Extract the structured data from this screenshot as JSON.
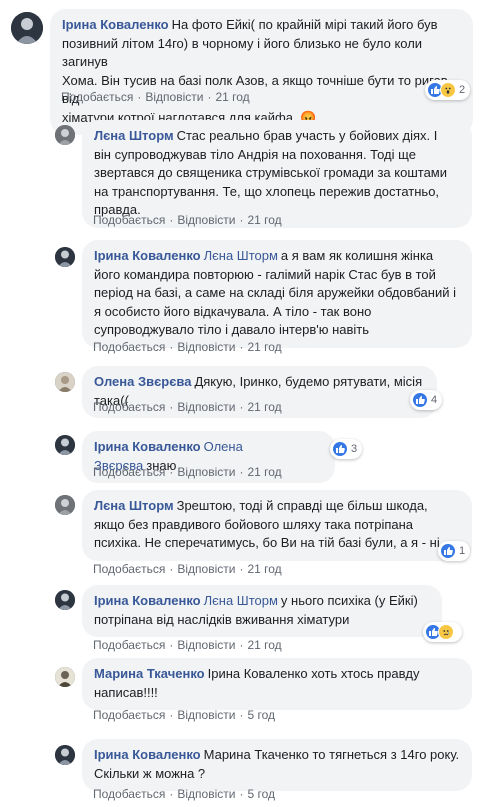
{
  "actions": {
    "like": "Подобається",
    "reply": "Відповісти",
    "dot": "·"
  },
  "comments": [
    {
      "author": "Ірина Коваленко",
      "text_lines": [
        "На фото Ейкі( по крайній мірі такий його був",
        "позивний літом 14го) в чорному і його близько не було коли загинув",
        "Хома. Він тусив на базі полк Азов, а якщо точніше бути то ригав від",
        "хіматури котрої наглотався для кайфа. 😡"
      ],
      "time": "21 год",
      "reactions": {
        "icons": [
          "like-icon",
          "wow-icon"
        ],
        "count": "2"
      }
    },
    {
      "author": "Лєна Шторм",
      "text_lines": [
        "Стас реально брав участь у бойових діях. І",
        "він супроводжував тіло Андрія на поховання. Тоді ще",
        "звертався до священика струмівської громади за коштами",
        "на транспортування. Те, що хлопець пережив достатньо,",
        "правда."
      ],
      "time": "21 год"
    },
    {
      "author": "Ірина Коваленко",
      "mention": "Лєна Шторм",
      "text_lines": [
        "а я вам як колишня жінка",
        "його командира повторюю - галімий нарік Стас був в той",
        "період на базі, а саме на складі біля аружейки обдовбаний і",
        "я особисто його відкачувала. А тіло - так воно",
        "супроводжувало тіло і давало інтерв'ю навіть"
      ],
      "time": "21 год"
    },
    {
      "author": "Олена Звєрєва",
      "text_lines": [
        "Дякую, Іринко, будемо рятувати, місія така(("
      ],
      "time": "21 год",
      "reactions": {
        "icons": [
          "like-icon"
        ],
        "count": "4"
      }
    },
    {
      "author": "Ірина Коваленко",
      "mention": "Олена Звєрєва",
      "text_lines": [
        "знаю"
      ],
      "time": "21 год",
      "reactions": {
        "icons": [
          "like-icon"
        ],
        "count": "3"
      }
    },
    {
      "author": "Лєна Шторм",
      "text_lines": [
        "Зрештою, тоді й справді ще більш шкода,",
        "якщо без правдивого бойового шляху така потріпана",
        "психіка. Не сперечатимусь, бо Ви на тій базі були, а я - ні."
      ],
      "time": "21 год",
      "reactions": {
        "icons": [
          "like-icon"
        ],
        "count": "1"
      }
    },
    {
      "author": "Ірина Коваленко",
      "mention": "Лєна Шторм",
      "text_lines": [
        "у нього психіка (у Ейкі)",
        "потріпана від наслідків вживання хіматури"
      ],
      "time": "21 год",
      "reactions": {
        "icons": [
          "like-icon",
          "sad-icon"
        ],
        "count": ""
      }
    },
    {
      "author": "Марина Ткаченко",
      "text_lines": [
        "Ірина Коваленко хоть хтось правду",
        "написав!!!!"
      ],
      "time": "5 год"
    },
    {
      "author": "Ірина Коваленко",
      "text_lines": [
        "Марина Ткаченко то тягнеться з 14го року.",
        "Скільки ж можна ?"
      ],
      "time": "5 год"
    }
  ],
  "colors": {
    "link": "#385898",
    "bubble": "#f2f3f5",
    "meta": "#616770",
    "like": "#3578e5"
  }
}
